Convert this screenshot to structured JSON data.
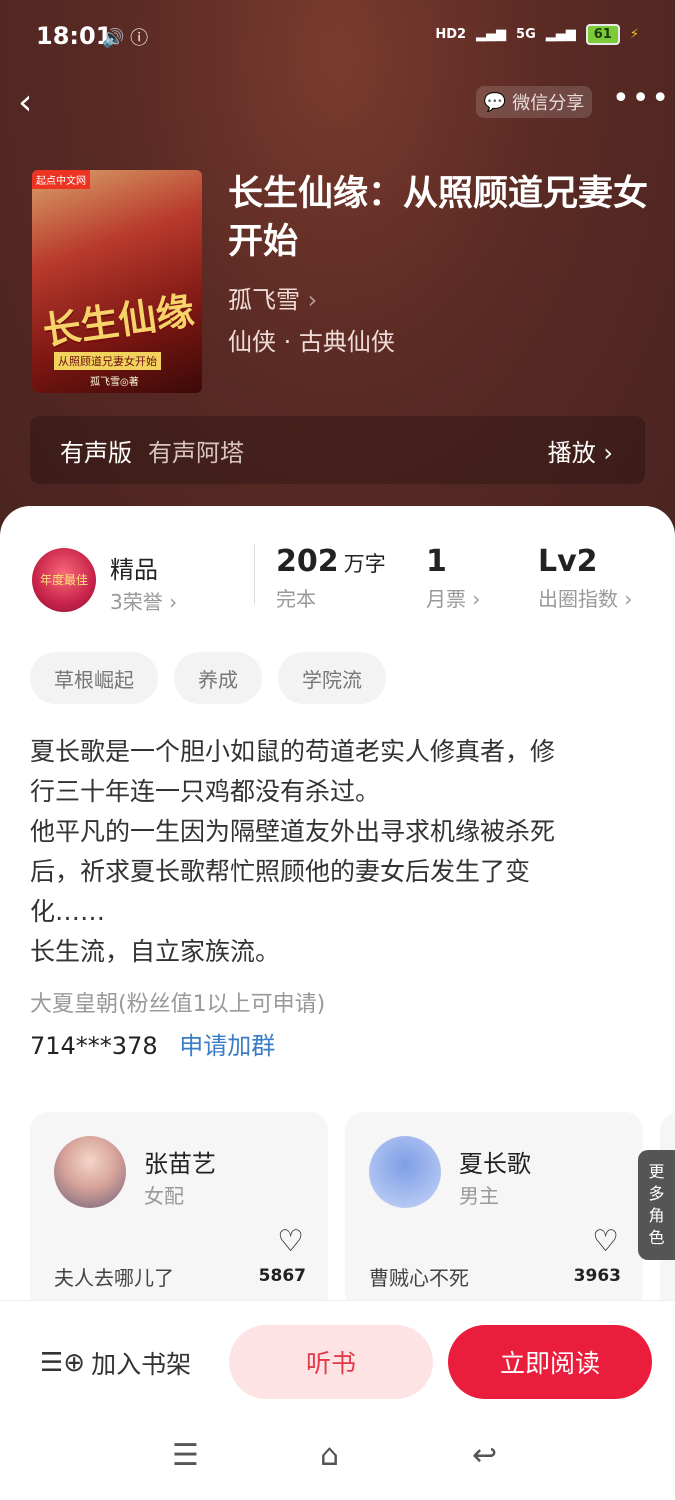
{
  "status_bar": {
    "time": "18:01",
    "battery": "61",
    "network_a": "HD2",
    "network_b": "5G"
  },
  "nav": {
    "share_label": "微信分享"
  },
  "book": {
    "title": "长生仙缘：从照顾道兄妻女开始",
    "author": "孤飞雪",
    "genre": "仙侠 · 古典仙侠",
    "cover_title": "长生仙缘",
    "cover_subtitle": "从照顾道兄妻女开始",
    "cover_author": "孤飞雪◎著"
  },
  "audio": {
    "label": "有声版",
    "narrator": "有声阿塔",
    "play_label": "播放"
  },
  "stats": {
    "tier_label": "精品",
    "honor": "3荣誉",
    "medal_text": "年度最佳",
    "words_value": "202",
    "words_unit": "万字",
    "words_label": "完本",
    "tickets_value": "1",
    "tickets_label": "月票",
    "level_value": "Lv2",
    "level_label": "出圈指数"
  },
  "tags": [
    "草根崛起",
    "养成",
    "学院流"
  ],
  "description": [
    "夏长歌是一个胆小如鼠的苟道老实人修真者，修",
    "行三十年连一只鸡都没有杀过。",
    "他平凡的一生因为隔壁道友外出寻求机缘被杀死",
    "后，祈求夏长歌帮忙照顾他的妻女后发生了变",
    "化……",
    "长生流，自立家族流。"
  ],
  "fan_group": {
    "name": "大夏皇朝(粉丝值1以上可申请)",
    "number": "714***378",
    "apply_label": "申请加群"
  },
  "characters": [
    {
      "name": "张苗艺",
      "role": "女配",
      "quote": "夫人去哪儿了",
      "likes": "5867"
    },
    {
      "name": "夏长歌",
      "role": "男主",
      "quote": "曹贼心不死",
      "likes": "3963"
    }
  ],
  "more_roles": [
    "更",
    "多",
    "角",
    "色"
  ],
  "bottom_bar": {
    "shelf_label": "加入书架",
    "listen_label": "听书",
    "read_label": "立即阅读"
  },
  "colors": {
    "accent": "#ea1d3d",
    "accent_light": "#fde3e3",
    "link": "#3a7cc6",
    "hero_bg": "#5a2a24"
  }
}
